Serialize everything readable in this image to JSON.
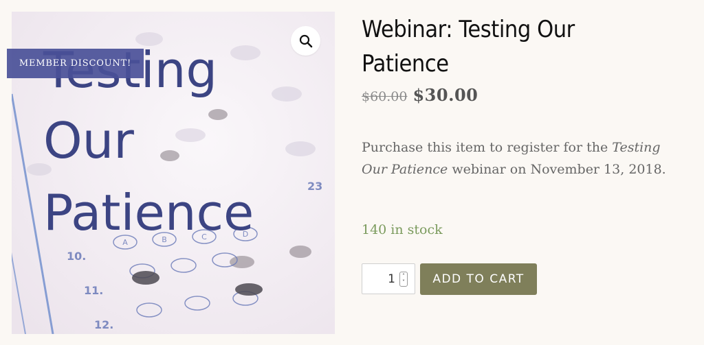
{
  "product": {
    "image": {
      "heading_lines": [
        "Testing",
        "Our",
        "Patience"
      ],
      "question_numbers": [
        "10.",
        "11.",
        "12.",
        "23"
      ],
      "bubble_letters": [
        "A",
        "B",
        "C",
        "D"
      ],
      "icon": "answer-sheet-image"
    },
    "badge": "MEMBER DISCOUNT!",
    "zoom_icon": "magnifier-icon",
    "title": "Webinar: Testing Our Patience",
    "price_old": "$60.00",
    "price_new": "$30.00",
    "description": {
      "before": "Purchase this item to register for the ",
      "italic": "Testing Our Patience",
      "after": " webinar on November 13, 2018."
    },
    "stock": "140 in stock",
    "quantity": "1",
    "add_to_cart": "ADD TO CART"
  },
  "colors": {
    "background": "#fbf8f4",
    "badge": "#4a5098",
    "button": "#7f7f5a",
    "stock": "#7a9a5c"
  }
}
